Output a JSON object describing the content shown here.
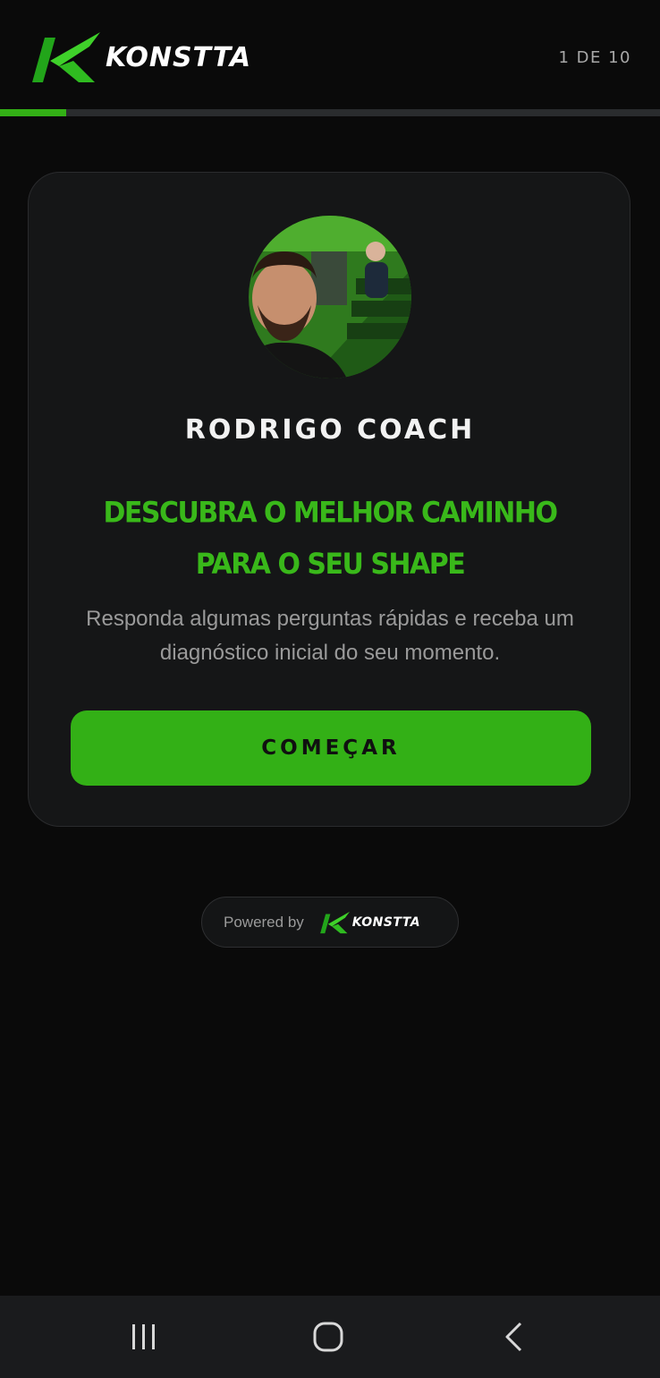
{
  "header": {
    "brand": "KONSTTA",
    "step_counter": "1 DE 10",
    "progress": 0.1,
    "accent_color": "#33b016"
  },
  "card": {
    "avatar_icon": "coach-photo",
    "coach_name": "RODRIGO COACH",
    "headline": "DESCUBRA O MELHOR CAMINHO PARA O SEU SHAPE",
    "subtitle": "Responda algumas perguntas rápidas e receba um diagnóstico inicial do seu momento.",
    "start_button": "COMEÇAR"
  },
  "footer": {
    "powered_by": "Powered by",
    "brand": "KONSTTA"
  },
  "navbar": {
    "icons": [
      "recent-apps-icon",
      "home-icon",
      "back-icon"
    ]
  }
}
